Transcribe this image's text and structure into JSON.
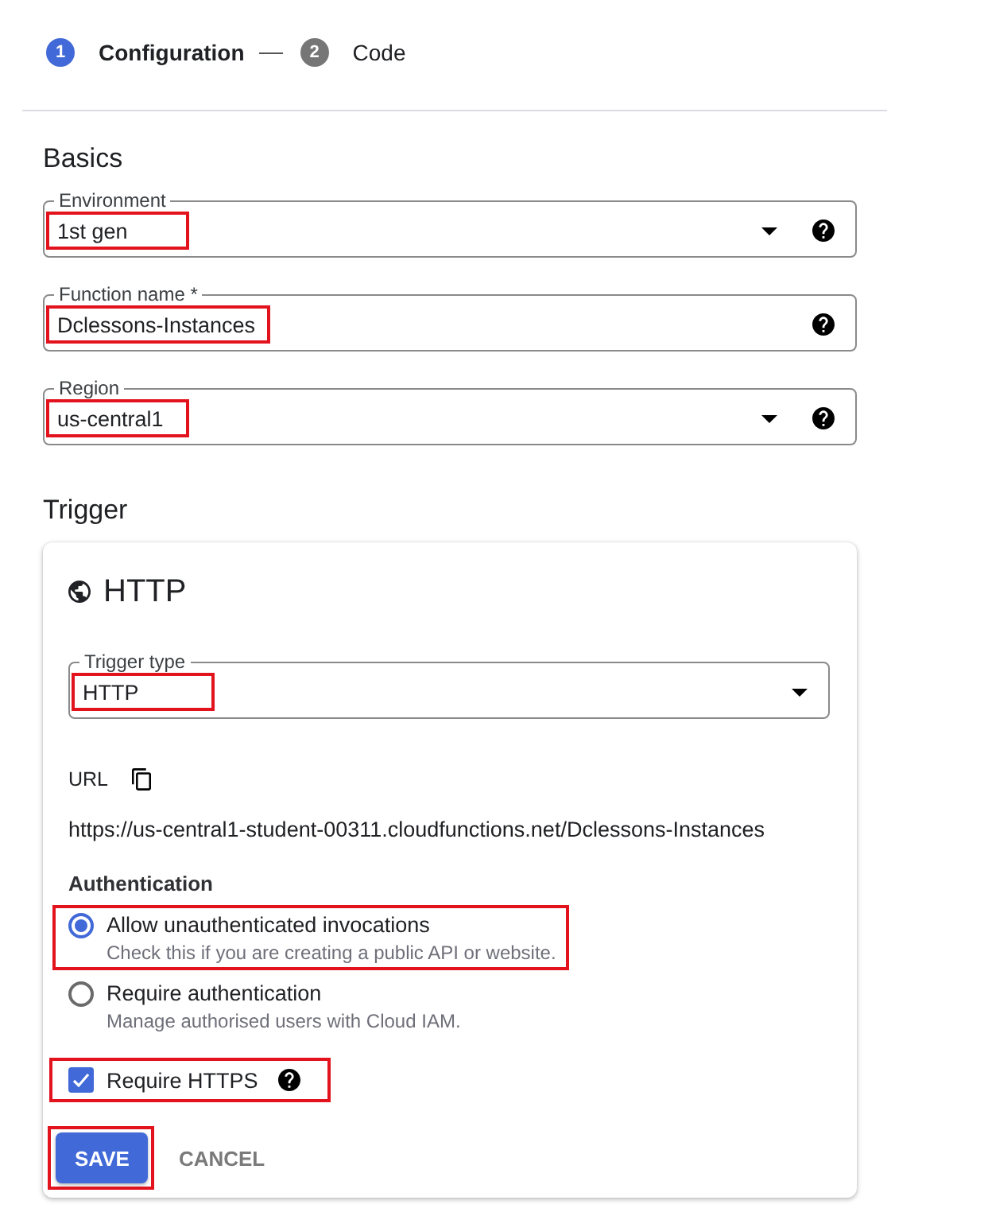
{
  "stepper": {
    "steps": [
      {
        "number": "1",
        "label": "Configuration",
        "selected": true
      },
      {
        "number": "2",
        "label": "Code",
        "selected": false
      }
    ]
  },
  "basics": {
    "title": "Basics",
    "fields": [
      {
        "kind": "select",
        "label": "Environment",
        "value": "1st gen",
        "help": true,
        "highlighted": true
      },
      {
        "kind": "text",
        "label": "Function name *",
        "value": "Dclessons-Instances",
        "help": true,
        "highlighted": true
      },
      {
        "kind": "select",
        "label": "Region",
        "value": "us-central1",
        "help": true,
        "highlighted": true
      }
    ]
  },
  "trigger": {
    "title": "Trigger",
    "card": {
      "title": "HTTP",
      "trigger_type": {
        "kind": "select",
        "label": "Trigger type",
        "value": "HTTP",
        "highlighted": true
      },
      "url_label": "URL",
      "url": "https://us-central1-student-00311.cloudfunctions.net/Dclessons-Instances",
      "authentication": {
        "title": "Authentication",
        "options": [
          {
            "label": "Allow unauthenticated invocations",
            "description": "Check this if you are creating a public API or website.",
            "selected": true,
            "highlighted": true
          },
          {
            "label": "Require authentication",
            "description": "Manage authorised users with Cloud IAM.",
            "selected": false,
            "highlighted": false
          }
        ]
      },
      "require_https": {
        "label": "Require HTTPS",
        "checked": true,
        "help": true,
        "highlighted": true
      },
      "buttons": [
        {
          "kind": "primary",
          "label": "SAVE",
          "highlighted": true
        },
        {
          "kind": "text",
          "label": "CANCEL",
          "highlighted": false
        }
      ]
    }
  }
}
